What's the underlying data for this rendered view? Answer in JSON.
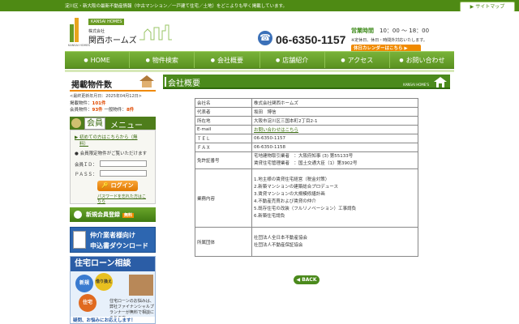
{
  "topbar": {
    "tagline": "淀川区・新大阪の最新不動産情報（中古マンション／一戸建て住宅／土地）をどこよりも早く掲載しています。",
    "sitemap": "サイトマップ"
  },
  "logo": {
    "tag": "KANSAI HOMES",
    "sub": "株式会社",
    "name": "関西ホームズ",
    "en": "KANSAI HOMES"
  },
  "contact": {
    "phone": "06-6350-1157",
    "hours_label": "営業時間",
    "hours_value": "10：00 ～ 18：00",
    "note": "※定休日、休日・時間外対応いたします。",
    "calendar_button": "休日カレンダーはこちら"
  },
  "nav": [
    {
      "label": "HOME"
    },
    {
      "label": "物件検索"
    },
    {
      "label": "会社概要"
    },
    {
      "label": "店舗紹介"
    },
    {
      "label": "アクセス"
    },
    {
      "label": "お問い合わせ"
    }
  ],
  "sidebar": {
    "title": "掲載物件数",
    "updated": "<最終更新年月日：2025年04月12日>",
    "total_label": "掲載物件：",
    "total_value": "101件",
    "members_label": "会員物件：",
    "members_value": "93件",
    "general_label": "一般物件：",
    "general_value": "8件",
    "member_menu_title1": "会員",
    "member_menu_title2": "メニュー",
    "first_time_link1": "初めての方はこちらから（無",
    "first_time_link2": "料）",
    "login_note": "会員限定物件がご覧いただけます",
    "id_label": "会員ＩＤ：",
    "pass_label": "ＰＡＳＳ：",
    "login_button": "ログイン",
    "forgot_link1": "パスワードを忘れた方はこ",
    "forgot_link2": "ちら",
    "register_button": "新規会員登録",
    "register_free": "無料",
    "dl_line1": "仲介業者様向け",
    "dl_line2": "申込書ダウンロード",
    "loan_title": "住宅ローン相談",
    "loan_c1": "新規",
    "loan_c2": "借り換え",
    "loan_c3": "住宅",
    "loan_desc": "住宅ローンのお悩みは、弊社ファイナンシャルプランナーが無料で相談にのります。",
    "loan_foot": "疑問、お悩みにお応えします！"
  },
  "main": {
    "title": "会社概要",
    "brand": "KANSAI HOME'S",
    "rows": [
      {
        "key": "会社名",
        "value": "株式会社関西ホームズ"
      },
      {
        "key": "代表者",
        "value": "坂田　博信"
      },
      {
        "key": "所在地",
        "value": "大阪市淀川区三国本町2丁目2-1"
      },
      {
        "key": "E-mail",
        "value": "お問い合わせはこちら"
      },
      {
        "key": "ＴＥＬ",
        "value": "06-6350-1157"
      },
      {
        "key": "ＦＡＸ",
        "value": "06-6350-1158"
      }
    ],
    "license_key": "免許証番号",
    "license_lines": [
      "宅地建物取引業者　：大阪府知事 (3) 第55133号",
      "賃貸住宅管理業者　：国土交通大臣（1）第3902号"
    ],
    "business_key": "業務内容",
    "business_lines": [
      "1.地主様の賃貸住宅経営（税金対策）",
      "2.新築マンションの建築総合プロデュース",
      "3.賃貸マンションの大規模修繕計画",
      "4.不動産売買および賃貸の仲介",
      "5.既存住宅の改装（フルリノベーション）工事請負",
      "6.新築住宅請負"
    ],
    "org_key": "所属団体",
    "org_lines": [
      "社団法人全日本不動産協会",
      "社団法人不動産保証協会"
    ],
    "back": "BACK"
  }
}
